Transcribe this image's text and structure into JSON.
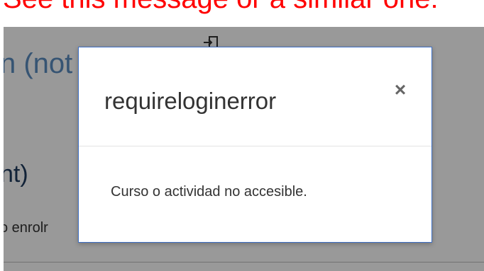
{
  "banner": {
    "text": "See this message or a similar one:",
    "color": "#ff0000"
  },
  "background": {
    "heading_fragment": "n (not",
    "subheading_fragment": "nt)",
    "text_fragment": "o enrolr",
    "login_icon": "login-icon"
  },
  "modal": {
    "title": "requireloginerror",
    "close_symbol": "×",
    "message": "Curso o actividad no accesible.",
    "border_color": "#3d6fc6"
  }
}
